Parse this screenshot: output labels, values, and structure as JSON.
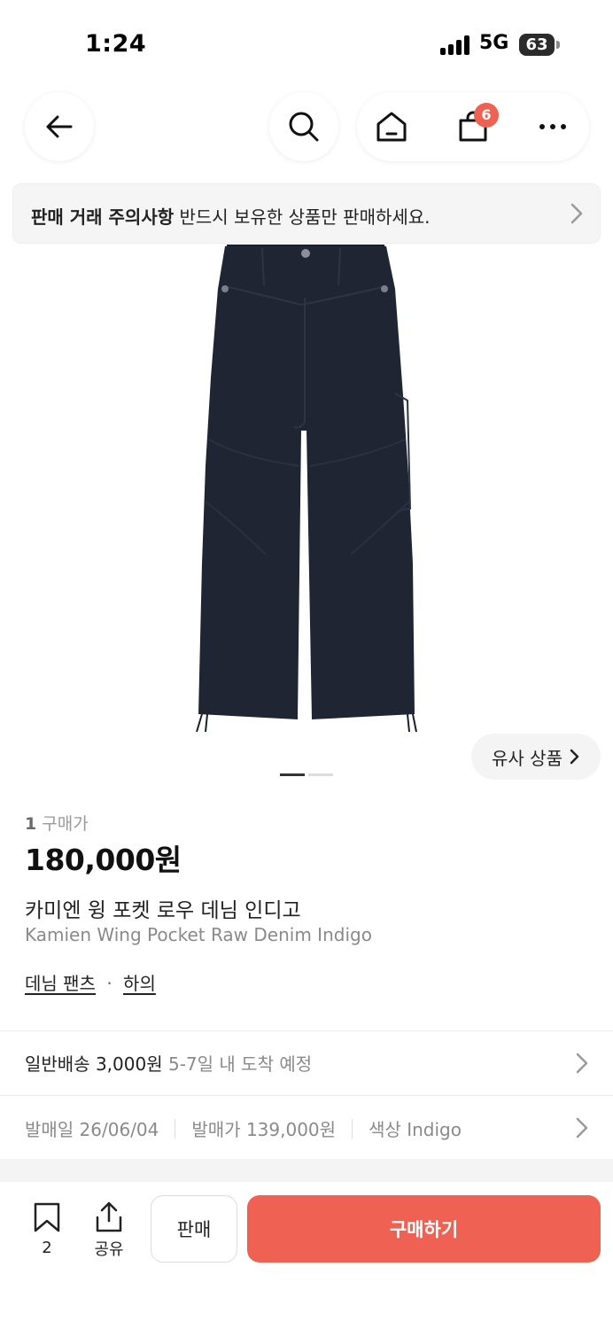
{
  "status_bar": {
    "time": "1:24",
    "network": "5G",
    "battery": "63"
  },
  "nav": {
    "cart_count": "6"
  },
  "notice": {
    "bold_text": "판매 거래 주의사항",
    "text": "반드시 보유한 상품만 판매하세요."
  },
  "image": {
    "alt": "카미엔 윙 포켓 로우 데님 인디고",
    "page_count": 2,
    "current_page": 1
  },
  "similar": {
    "label": "유사 상품"
  },
  "product": {
    "price_rank": "1",
    "price_label": "구매가",
    "price": "180,000원",
    "name_ko": "카미엔 윙 포켓 로우 데님 인디고",
    "name_en": "Kamien Wing Pocket Raw Denim Indigo",
    "category_1": "데님 팬츠",
    "category_sep": "·",
    "category_2": "하의"
  },
  "shipping": {
    "label": "일반배송 3,000원",
    "eta": "5-7일 내 도착 예정"
  },
  "release": {
    "date": "발매일 26/06/04",
    "retail_price": "발매가 139,000원",
    "color": "색상 Indigo"
  },
  "bottom_bar": {
    "bookmark_count": "2",
    "share_label": "공유",
    "sell_label": "판매",
    "buy_label": "구매하기"
  },
  "colors": {
    "accent": "#ef6253",
    "denim": "#1f2533"
  }
}
